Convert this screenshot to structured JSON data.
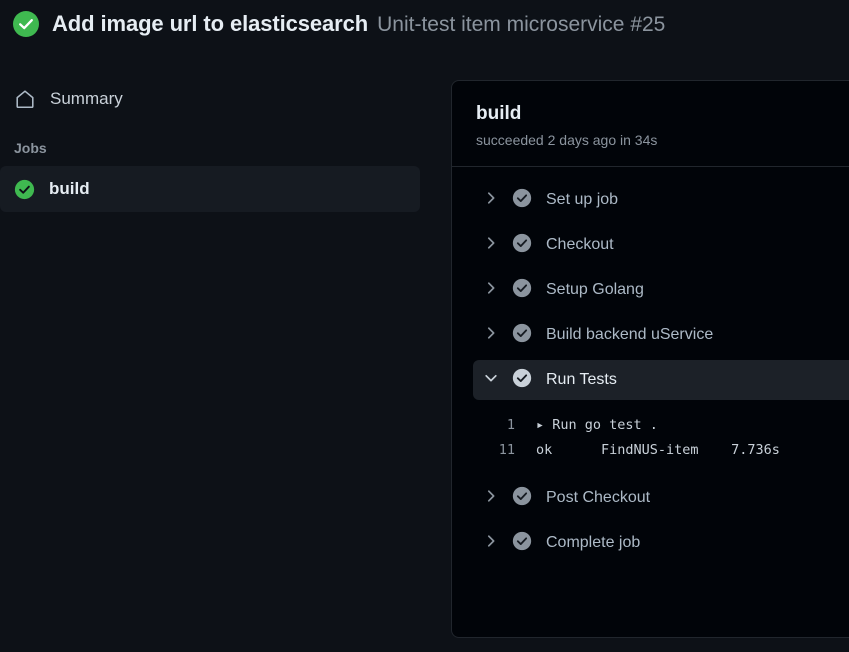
{
  "header": {
    "status_icon": "success-check-icon",
    "title": "Add image url to elasticsearch",
    "subtitle": "Unit-test item microservice #25",
    "accent_green": "#3fb950"
  },
  "sidebar": {
    "summary": {
      "icon": "home-icon",
      "label": "Summary"
    },
    "jobs_heading": "Jobs",
    "jobs": [
      {
        "label": "build",
        "status_icon": "success-check-icon",
        "selected": true
      }
    ]
  },
  "panel": {
    "title": "build",
    "status_line": "succeeded 2 days ago in 34s",
    "steps": [
      {
        "label": "Set up job",
        "toggle_icon": "chevron-right-icon",
        "status_icon": "check-circle-icon",
        "expanded": false
      },
      {
        "label": "Checkout",
        "toggle_icon": "chevron-right-icon",
        "status_icon": "check-circle-icon",
        "expanded": false
      },
      {
        "label": "Setup Golang",
        "toggle_icon": "chevron-right-icon",
        "status_icon": "check-circle-icon",
        "expanded": false
      },
      {
        "label": "Build backend uService",
        "toggle_icon": "chevron-right-icon",
        "status_icon": "check-circle-icon",
        "expanded": false
      },
      {
        "label": "Run Tests",
        "toggle_icon": "chevron-down-icon",
        "status_icon": "check-circle-icon",
        "expanded": true
      },
      {
        "label": "Post Checkout",
        "toggle_icon": "chevron-right-icon",
        "status_icon": "check-circle-icon",
        "expanded": false
      },
      {
        "label": "Complete job",
        "toggle_icon": "chevron-right-icon",
        "status_icon": "check-circle-icon",
        "expanded": false
      }
    ],
    "log": [
      {
        "number": "1",
        "text": "▸ Run go test ."
      },
      {
        "number": "11",
        "text": "ok      FindNUS-item    7.736s"
      }
    ]
  },
  "colors": {
    "page_bg": "#0d1117",
    "panel_bg": "#010409",
    "selected_row_bg": "#161b22",
    "expanded_row_bg": "#1c2128",
    "border": "#21262d",
    "text_primary": "#e6edf3",
    "text_muted": "#8b949e"
  }
}
